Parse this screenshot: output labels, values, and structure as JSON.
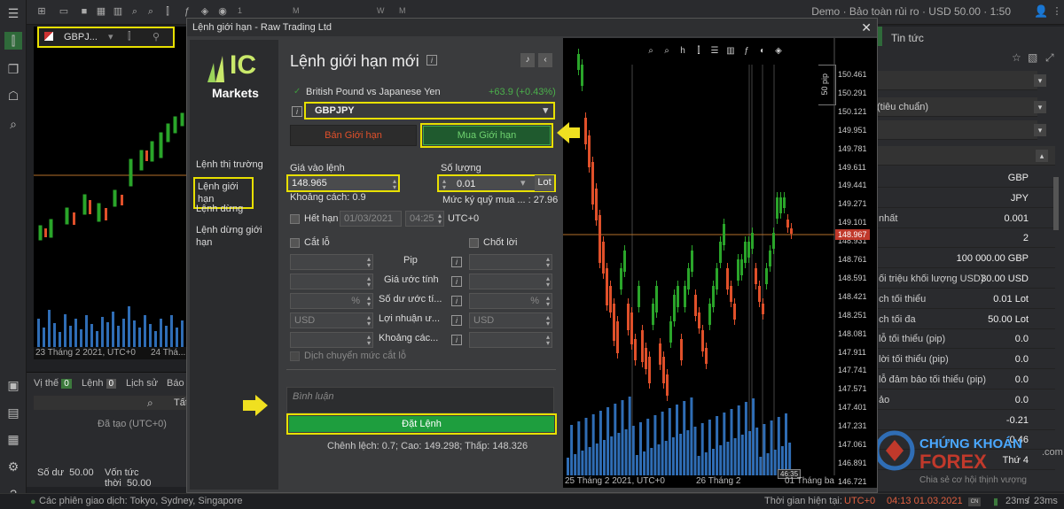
{
  "topbar": {
    "timeframes": [
      "1",
      "",
      "",
      "M",
      "",
      "",
      "",
      "",
      "",
      "",
      "",
      "W",
      "",
      "M",
      "1"
    ],
    "account": "Demo · Bảo toàn rủi ro · USD 50.00 · 1:50"
  },
  "bgchart": {
    "symbol": "GBPJ...",
    "date_left": "23 Tháng 2 2021, UTC+0",
    "date_right": "24 Thá..."
  },
  "positions": {
    "tab_positions": "Vị thế",
    "count_positions": "0",
    "tab_orders": "Lệnh",
    "count_orders": "0",
    "tab_history": "Lịch sử",
    "tab_more": "Báo",
    "filter": "Tất",
    "created": "Đã tạo (UTC+0)",
    "balance_label": "Số dư",
    "balance_value": "50.00",
    "equity_label": "Vốn tức thời",
    "equity_value": "50.00"
  },
  "status": {
    "sessions": "Các phiên giao dịch: Tokyo, Sydney, Singapore",
    "server_time_label": "Thời gian hiện tại:",
    "timezone": "UTC+0",
    "server_time": "04:13 01.03.2021",
    "latency1": "23ms",
    "latency2": "23ms"
  },
  "rightpanel": {
    "tab_news": "Tin tức",
    "select2": "(tiêu chuẩn)",
    "rows": [
      {
        "k": "",
        "v": "GBP"
      },
      {
        "k": "",
        "v": "JPY"
      },
      {
        "k": "nhất",
        "v": "0.001"
      },
      {
        "k": "",
        "v": "2"
      },
      {
        "k": "",
        "v": "100 000.00 GBP"
      },
      {
        "k": "ối triệu khối lượng USD)",
        "v": "30.00 USD"
      },
      {
        "k": "ch tối thiểu",
        "v": "0.01 Lot"
      },
      {
        "k": "ch tối đa",
        "v": "50.00 Lot"
      },
      {
        "k": "lỗ tối thiểu (pip)",
        "v": "0.0"
      },
      {
        "k": "lời tối thiểu (pip)",
        "v": "0.0"
      },
      {
        "k": "lỗ đảm bảo tối thiểu (pip)",
        "v": "0.0"
      },
      {
        "k": "ảo",
        "v": "0.0"
      },
      {
        "k": "",
        "v": "-0.21"
      },
      {
        "k": "",
        "v": "-0.46"
      },
      {
        "k": "",
        "v": "Thứ 4"
      }
    ]
  },
  "watermark": {
    "line1": "CHỨNG KHOÁN",
    "line2": "FOREX",
    "line3": "Chia sẻ cơ hội thịnh vượng",
    "site": ".com"
  },
  "dialog": {
    "title": "Lệnh giới hạn - Raw Trading Ltd",
    "logo_ic": "IC",
    "logo_markets": "Markets",
    "menu": [
      "Lệnh thị trường",
      "Lệnh giới hạn",
      "Lệnh dừng",
      "Lệnh dừng giới hạn"
    ],
    "form_title": "Lệnh giới hạn mới",
    "instrument": "British Pound vs Japanese Yen",
    "change": "+63.9 (+0.43%)",
    "symbol": "GBPJPY",
    "sell_label": "Bán Giới hạn",
    "buy_label": "Mua Giới hạn",
    "entry_label": "Giá vào lệnh",
    "entry_value": "148.965",
    "qty_label": "Số lượng",
    "qty_value": "0.01",
    "qty_unit": "Lot",
    "distance": "Khoảng cách: 0.9",
    "margin_label": "Mức ký quỹ mua ... :",
    "margin_value": "27.96",
    "expiry_label": "Hết hạn",
    "expiry_date": "01/03/2021",
    "expiry_time": "04:25",
    "expiry_tz": "UTC+0",
    "sl_label": "Cắt lỗ",
    "tp_label": "Chốt lời",
    "pip_label": "Pip",
    "est_label": "Giá ước tính",
    "balance_est_label": "Số dư ước tí...",
    "pnl_label": "Lợi nhuận ư...",
    "distance2_label": "Khoảng các...",
    "percent": "%",
    "usd": "USD",
    "trailing": "Dịch chuyển mức cắt lỗ",
    "comment_ph": "Bình luận",
    "submit": "Đặt Lệnh",
    "stats": "Chênh lệch: 0.7; Cao: 149.298; Thấp: 148.326"
  },
  "chart": {
    "pip_label": "50 pip",
    "prices": [
      "150.461",
      "150.291",
      "150.121",
      "149.951",
      "149.781",
      "149.611",
      "149.441",
      "149.271",
      "149.101",
      "148.931",
      "148.761",
      "148.591",
      "148.421",
      "148.251",
      "148.081",
      "147.911",
      "147.741",
      "147.571",
      "147.401",
      "147.231",
      "147.061",
      "146.891",
      "146.721"
    ],
    "current": "148.967",
    "date1": "25 Tháng 2 2021, UTC+0",
    "date2": "26 Tháng 2",
    "date3": "01 Tháng ba",
    "time_tag": "46:35"
  }
}
